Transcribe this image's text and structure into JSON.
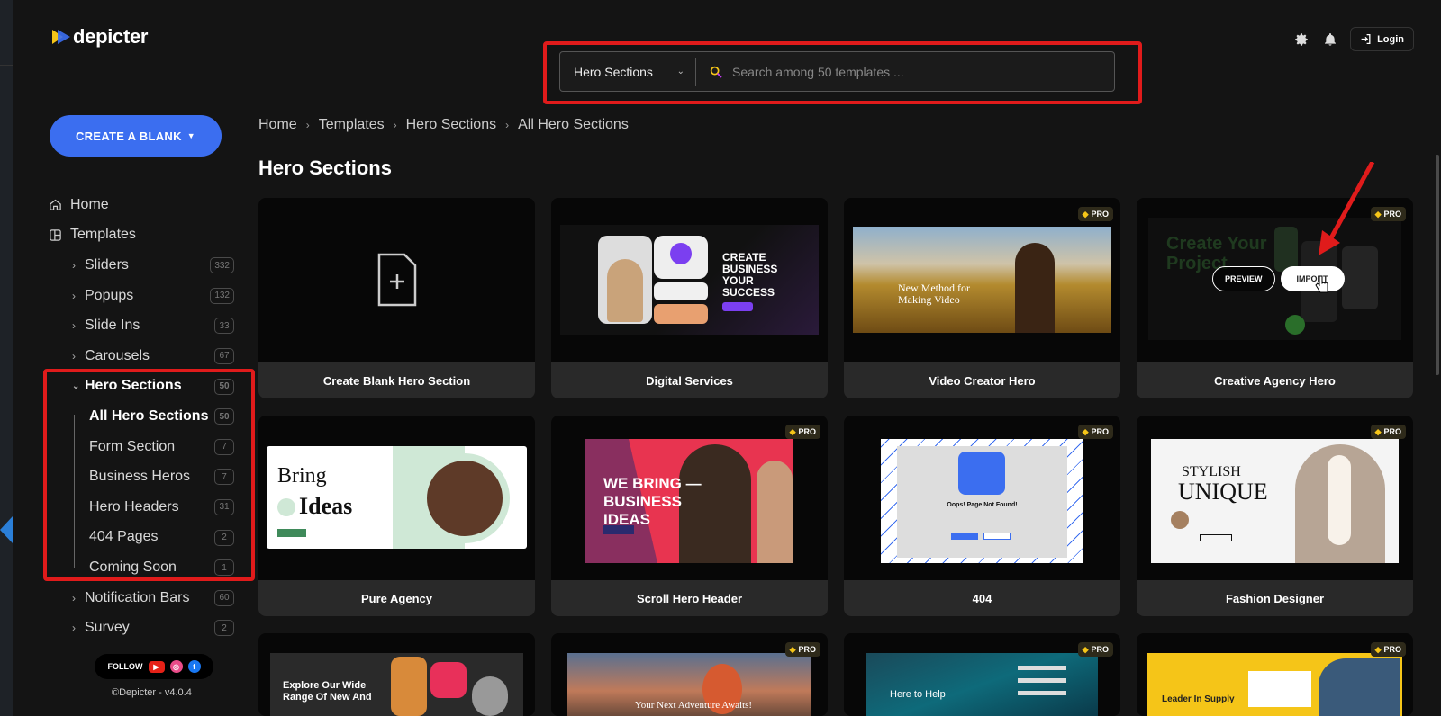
{
  "app": {
    "brand": "depicter"
  },
  "header": {
    "login_label": "Login"
  },
  "search": {
    "category": "Hero Sections",
    "placeholder": "Search among 50 templates ..."
  },
  "sidebar": {
    "create_label": "CREATE A BLANK",
    "items": [
      {
        "label": "Home",
        "count": ""
      },
      {
        "label": "Templates",
        "count": ""
      },
      {
        "label": "Sliders",
        "count": "332"
      },
      {
        "label": "Popups",
        "count": "132"
      },
      {
        "label": "Slide Ins",
        "count": "33"
      },
      {
        "label": "Carousels",
        "count": "67"
      },
      {
        "label": "Hero Sections",
        "count": "50"
      },
      {
        "label": "Notification Bars",
        "count": "60"
      },
      {
        "label": "Survey",
        "count": "2"
      }
    ],
    "sub_items": [
      {
        "label": "All Hero Sections",
        "count": "50"
      },
      {
        "label": "Form Section",
        "count": "7"
      },
      {
        "label": "Business Heros",
        "count": "7"
      },
      {
        "label": "Hero Headers",
        "count": "31"
      },
      {
        "label": "404 Pages",
        "count": "2"
      },
      {
        "label": "Coming Soon",
        "count": "1"
      }
    ],
    "follow_label": "FOLLOW",
    "copyright": "©Depicter - v4.0.4"
  },
  "breadcrumb": [
    "Home",
    "Templates",
    "Hero Sections",
    "All Hero Sections"
  ],
  "main": {
    "title": "Hero Sections",
    "pro_label": "PRO",
    "preview_label": "PREVIEW",
    "import_label": "IMPORT",
    "cards": [
      {
        "label": "Create Blank Hero Section",
        "pro": false
      },
      {
        "label": "Digital Services",
        "pro": false
      },
      {
        "label": "Video Creator Hero",
        "pro": true
      },
      {
        "label": "Creative Agency Hero",
        "pro": true
      },
      {
        "label": "Pure Agency",
        "pro": false
      },
      {
        "label": "Scroll Hero Header",
        "pro": true
      },
      {
        "label": "404",
        "pro": true
      },
      {
        "label": "Fashion Designer",
        "pro": true
      },
      {
        "label": "",
        "pro": false
      },
      {
        "label": "",
        "pro": true
      },
      {
        "label": "",
        "pro": true
      },
      {
        "label": "",
        "pro": true
      }
    ],
    "thumb_text": {
      "digital_title": "CREATE BUSINESS YOUR SUCCESS",
      "video_title": "New Method for Making Video",
      "agency_title": "Create Your Project",
      "pure_title1": "Bring",
      "pure_title2": "Ideas",
      "scroll_title": "WE BRING — BUSINESS IDEAS",
      "notfound_title": "Oops! Page Not Found!",
      "fashion_title1": "STYLISH",
      "fashion_title2": "UNIQUE",
      "row3_a": "Explore Our Wide Range Of New And",
      "row3_b": "Your Next Adventure Awaits!",
      "row3_c": "Here to Help",
      "row3_d": "Leader In Supply"
    }
  }
}
